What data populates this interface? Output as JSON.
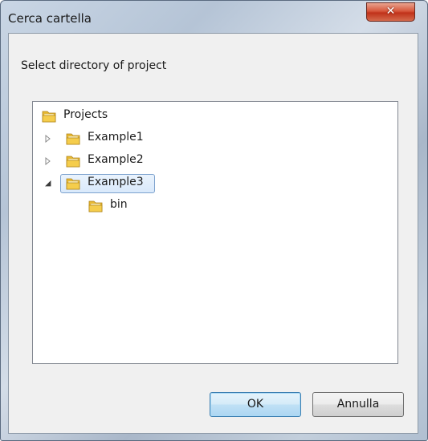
{
  "window": {
    "title": "Cerca cartella",
    "close_icon": "close-icon"
  },
  "dialog": {
    "prompt": "Select directory of project"
  },
  "tree": {
    "items": [
      {
        "label": "Projects",
        "icon": "folder-icon",
        "expander": "none",
        "selected": false
      },
      {
        "label": "Example1",
        "icon": "folder-icon",
        "expander": "collapsed",
        "selected": false
      },
      {
        "label": "Example2",
        "icon": "folder-icon",
        "expander": "collapsed",
        "selected": false
      },
      {
        "label": "Example3",
        "icon": "folder-icon",
        "expander": "expanded",
        "selected": true
      },
      {
        "label": "bin",
        "icon": "folder-icon",
        "expander": "none",
        "selected": false
      }
    ]
  },
  "buttons": {
    "ok_label": "OK",
    "cancel_label": "Annulla"
  },
  "colors": {
    "selection_border": "#7da2ce",
    "ok_border": "#3c7fb1",
    "close_red": "#c0321a"
  }
}
